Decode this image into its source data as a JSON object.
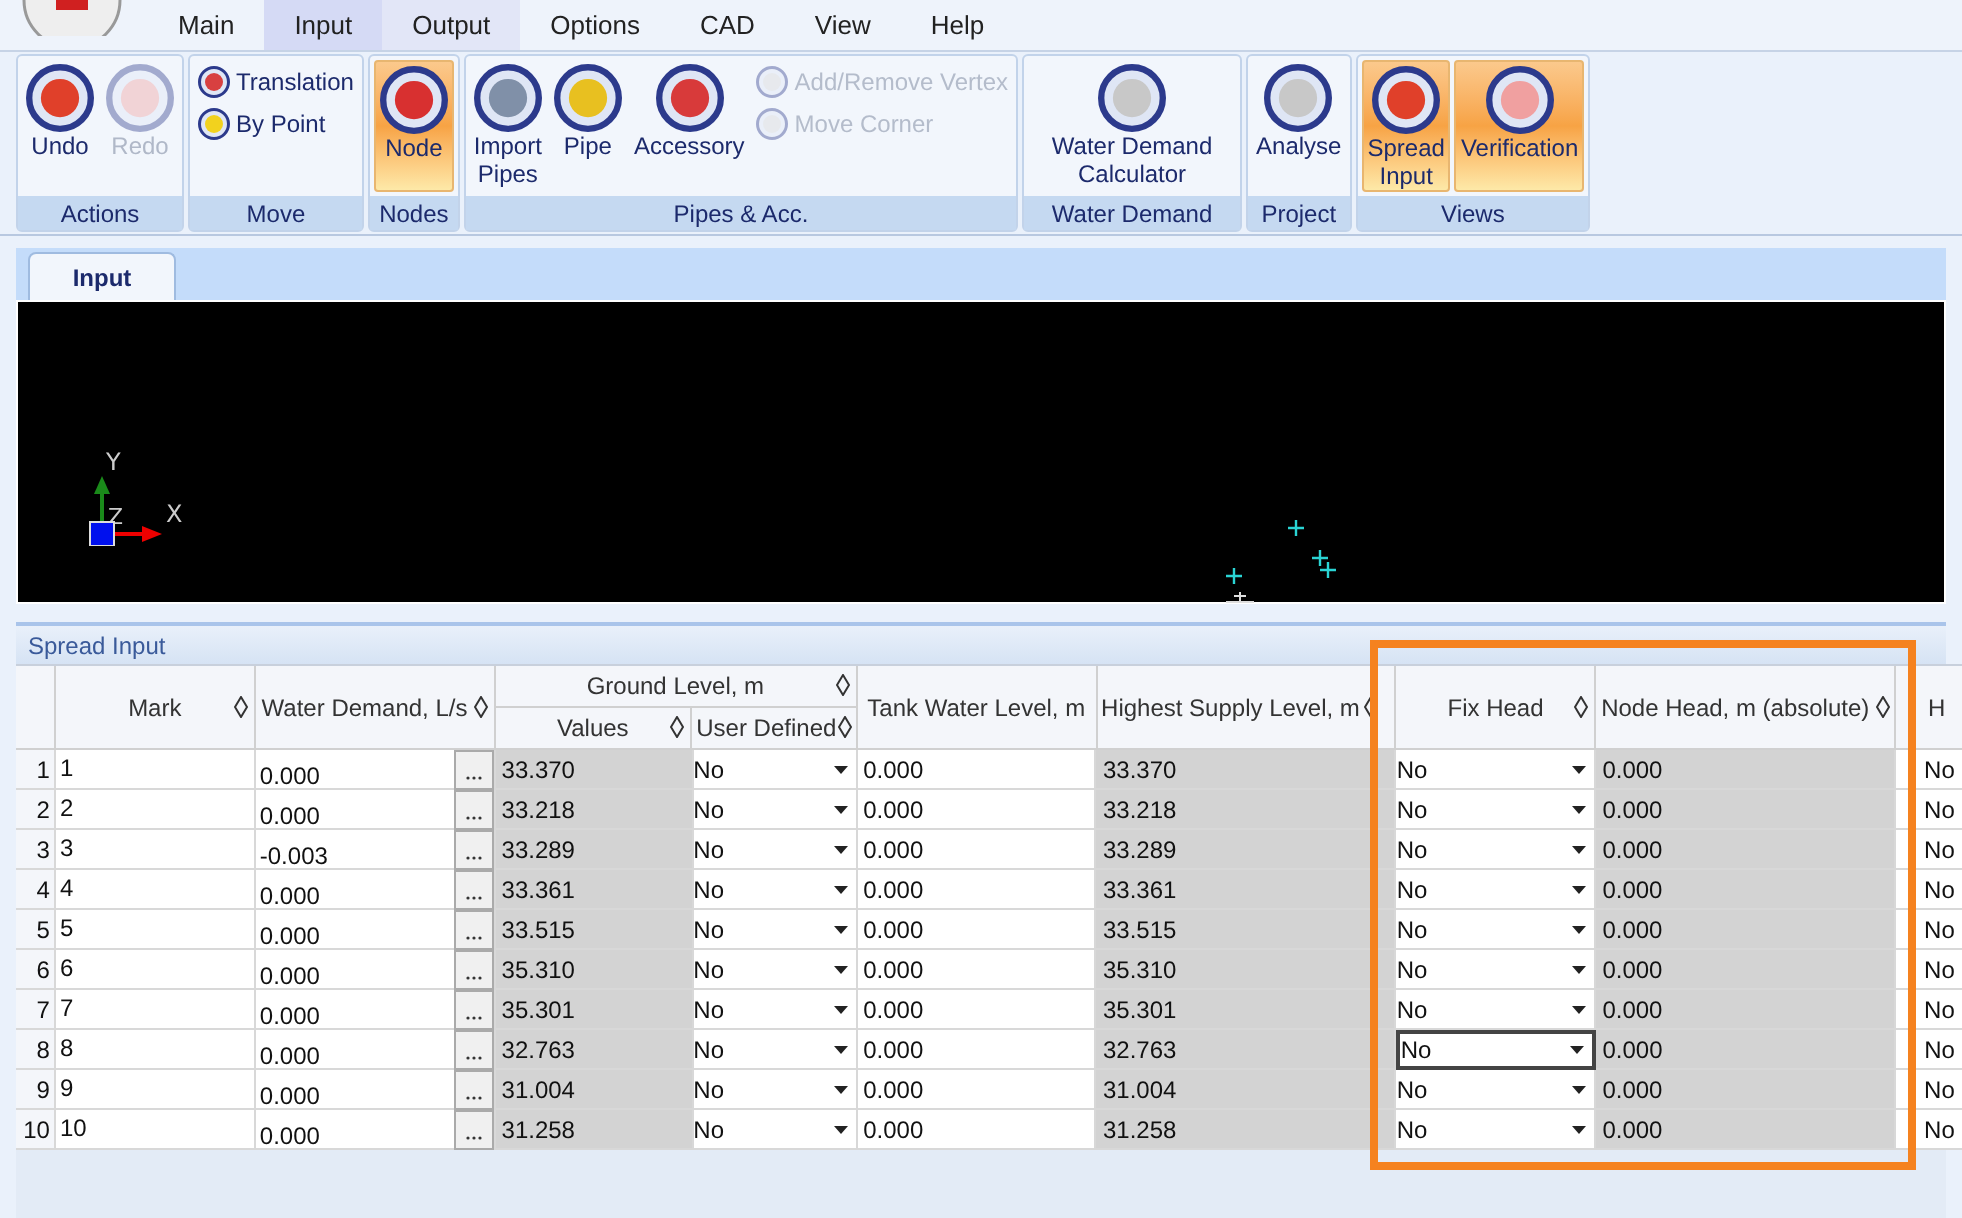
{
  "menu": [
    {
      "label": "Main",
      "selected": false,
      "hover": false
    },
    {
      "label": "Input",
      "selected": true,
      "hover": false
    },
    {
      "label": "Output",
      "selected": false,
      "hover": true
    },
    {
      "label": "Options",
      "selected": false,
      "hover": false
    },
    {
      "label": "CAD",
      "selected": false,
      "hover": false
    },
    {
      "label": "View",
      "selected": false,
      "hover": false
    },
    {
      "label": "Help",
      "selected": false,
      "hover": false
    }
  ],
  "ribbon": [
    {
      "title": "Actions",
      "buttons": [
        {
          "kind": "large",
          "label": "Undo",
          "active": false,
          "disabled": false
        },
        {
          "kind": "large",
          "label": "Redo",
          "active": false,
          "disabled": true
        }
      ]
    },
    {
      "title": "Move",
      "buttons": [
        {
          "kind": "small",
          "label": "Translation",
          "active": false,
          "disabled": false
        },
        {
          "kind": "small",
          "label": "By Point",
          "active": false,
          "disabled": false
        }
      ]
    },
    {
      "title": "Nodes",
      "buttons": [
        {
          "kind": "large",
          "label": "Node",
          "active": true,
          "disabled": false
        }
      ]
    },
    {
      "title": "Pipes & Acc.",
      "buttons": [
        {
          "kind": "large",
          "label": "Import Pipes",
          "active": false,
          "disabled": false
        },
        {
          "kind": "large",
          "label": "Pipe",
          "active": false,
          "disabled": false
        },
        {
          "kind": "large",
          "label": "Accessory",
          "active": false,
          "disabled": false
        },
        {
          "kind": "small",
          "label": "Add/Remove Vertex",
          "active": false,
          "disabled": true
        },
        {
          "kind": "small",
          "label": "Move Corner",
          "active": false,
          "disabled": true
        }
      ]
    },
    {
      "title": "Water Demand",
      "buttons": [
        {
          "kind": "large",
          "label": "Water Demand Calculator",
          "active": false,
          "disabled": false
        }
      ]
    },
    {
      "title": "Project",
      "buttons": [
        {
          "kind": "large",
          "label": "Analyse",
          "active": false,
          "disabled": false
        }
      ]
    },
    {
      "title": "Views",
      "buttons": [
        {
          "kind": "large",
          "label": "Spread Input",
          "active": true,
          "disabled": false
        },
        {
          "kind": "large",
          "label": "Verification",
          "active": true,
          "disabled": false
        }
      ]
    }
  ],
  "document_tabs": [
    {
      "label": "Input",
      "selected": true
    }
  ],
  "canvas": {
    "axis_labels": [
      "Y",
      "Z",
      "X"
    ]
  },
  "spread_input": {
    "title": "Spread Input",
    "columns": [
      "Mark",
      "Water Demand, L/s",
      "Values",
      "User Defined",
      "Tank Water Level, m",
      "Highest Supply Level, m",
      "Fix Head",
      "Node Head, m (absolute)",
      "H"
    ],
    "group_header": "Ground Level, m",
    "rows": [
      {
        "number": "1",
        "mark": "1",
        "water_demand": "0.000",
        "ground_level": "33.370",
        "user_defined": "No",
        "tank_level": "0.000",
        "highest_supply": "33.370",
        "fix_head": "No",
        "node_head": "0.000",
        "column_9": "No",
        "selected": false
      },
      {
        "number": "2",
        "mark": "2",
        "water_demand": "0.000",
        "ground_level": "33.218",
        "user_defined": "No",
        "tank_level": "0.000",
        "highest_supply": "33.218",
        "fix_head": "No",
        "node_head": "0.000",
        "column_9": "No",
        "selected": false
      },
      {
        "number": "3",
        "mark": "3",
        "water_demand": "-0.003",
        "ground_level": "33.289",
        "user_defined": "No",
        "tank_level": "0.000",
        "highest_supply": "33.289",
        "fix_head": "No",
        "node_head": "0.000",
        "column_9": "No",
        "selected": false
      },
      {
        "number": "4",
        "mark": "4",
        "water_demand": "0.000",
        "ground_level": "33.361",
        "user_defined": "No",
        "tank_level": "0.000",
        "highest_supply": "33.361",
        "fix_head": "No",
        "node_head": "0.000",
        "column_9": "No",
        "selected": false
      },
      {
        "number": "5",
        "mark": "5",
        "water_demand": "0.000",
        "ground_level": "33.515",
        "user_defined": "No",
        "tank_level": "0.000",
        "highest_supply": "33.515",
        "fix_head": "No",
        "node_head": "0.000",
        "column_9": "No",
        "selected": false
      },
      {
        "number": "6",
        "mark": "6",
        "water_demand": "0.000",
        "ground_level": "35.310",
        "user_defined": "No",
        "tank_level": "0.000",
        "highest_supply": "35.310",
        "fix_head": "No",
        "node_head": "0.000",
        "column_9": "No",
        "selected": false
      },
      {
        "number": "7",
        "mark": "7",
        "water_demand": "0.000",
        "ground_level": "35.301",
        "user_defined": "No",
        "tank_level": "0.000",
        "highest_supply": "35.301",
        "fix_head": "No",
        "node_head": "0.000",
        "column_9": "No",
        "selected": false
      },
      {
        "number": "8",
        "mark": "8",
        "water_demand": "0.000",
        "ground_level": "32.763",
        "user_defined": "No",
        "tank_level": "0.000",
        "highest_supply": "32.763",
        "fix_head": "No",
        "node_head": "0.000",
        "column_9": "No",
        "selected": true
      },
      {
        "number": "9",
        "mark": "9",
        "water_demand": "0.000",
        "ground_level": "31.004",
        "user_defined": "No",
        "tank_level": "0.000",
        "highest_supply": "31.004",
        "fix_head": "No",
        "node_head": "0.000",
        "column_9": "No",
        "selected": false
      },
      {
        "number": "10",
        "mark": "10",
        "water_demand": "0.000",
        "ground_level": "31.258",
        "user_defined": "No",
        "tank_level": "0.000",
        "highest_supply": "31.258",
        "fix_head": "No",
        "node_head": "0.000",
        "column_9": "No",
        "selected": false
      }
    ]
  }
}
